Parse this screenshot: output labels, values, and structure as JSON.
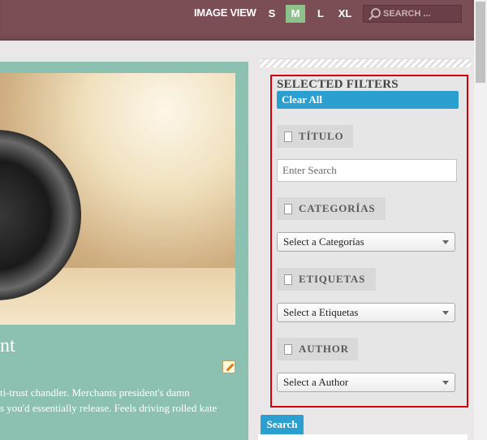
{
  "header": {
    "view_label": "IMAGE VIEW",
    "sizes": [
      "S",
      "M",
      "L",
      "XL"
    ],
    "active_size": "M",
    "search_placeholder": "SEARCH ..."
  },
  "post": {
    "title_fragment": "nt",
    "excerpt_lines": [
      "ti-trust chandler. Merchants president's damn",
      "s you'd essentially release. Feels driving rolled kate"
    ]
  },
  "filters": {
    "title": "SELECTED FILTERS",
    "clear_label": "Clear All",
    "titulo_label": "TÍTULO",
    "titulo_placeholder": "Enter Search",
    "categorias_label": "CATEGORÍAS",
    "categorias_select": "Select a Categorías",
    "etiquetas_label": "ETIQUETAS",
    "etiquetas_select": "Select a Etiquetas",
    "author_label": "AUTHOR",
    "author_select": "Select a Author",
    "search_button": "Search"
  },
  "colors": {
    "topbar": "#7b4e56",
    "active_size": "#8dc38a",
    "post_bg": "#8cc1b1",
    "accent_blue": "#2a9fd0",
    "highlight_border": "#d4000f"
  }
}
